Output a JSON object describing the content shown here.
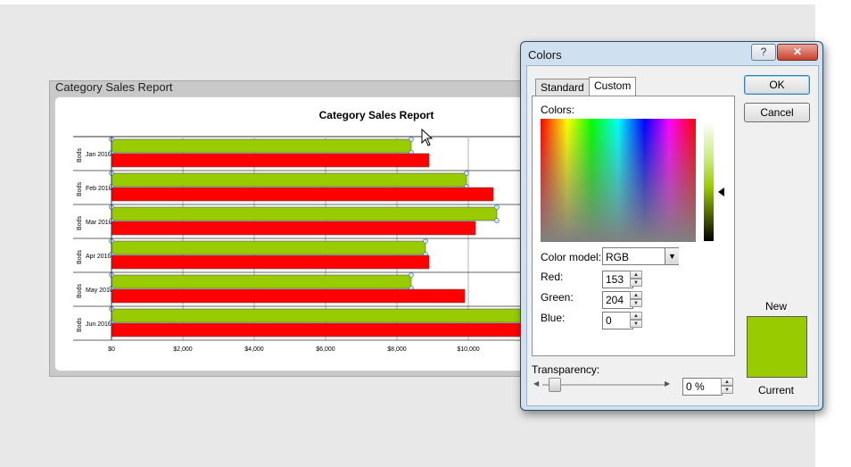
{
  "chart_window": {
    "title_bar": "Category Sales Report"
  },
  "chart_data": {
    "type": "bar",
    "title": "Category Sales Report",
    "categories": [
      "Jan 2010",
      "Feb 2010",
      "Mar 2010",
      "Apr 2010",
      "May 2010",
      "Jun 2010"
    ],
    "group_label": "Bods",
    "series": [
      {
        "values": [
          8400,
          9950,
          10800,
          8800,
          8400,
          12200
        ],
        "color": "#99cc00"
      },
      {
        "values": [
          8900,
          10700,
          10200,
          8900,
          9900,
          11800
        ],
        "color": "#ff0000"
      }
    ],
    "x_ticks": [
      "$0",
      "$2,000",
      "$4,000",
      "$6,000",
      "$8,000",
      "$10,000"
    ],
    "xlim": [
      0,
      12000
    ]
  },
  "dialog": {
    "title": "Colors",
    "help_glyph": "?",
    "close_glyph": "✕",
    "tabs": [
      "Standard",
      "Custom"
    ],
    "active_tab": "Custom",
    "ok_label": "OK",
    "cancel_label": "Cancel",
    "colors_label": "Colors:",
    "color_model_label": "Color model:",
    "color_model_value": "RGB",
    "red_label": "Red:",
    "green_label": "Green:",
    "blue_label": "Blue:",
    "red_value": "153",
    "green_value": "204",
    "blue_value": "0",
    "transparency_label": "Transparency:",
    "transparency_value": "0 %",
    "new_label": "New",
    "current_label": "Current",
    "new_color": "#99cc00",
    "transparency_fraction": 0
  }
}
